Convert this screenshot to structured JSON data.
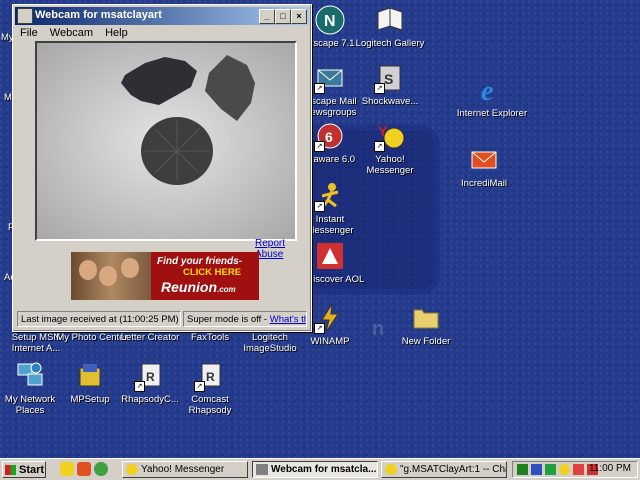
{
  "window": {
    "title": "Webcam for msatclayart",
    "menu": [
      "File",
      "Webcam",
      "Help"
    ],
    "report_abuse": "Report Abuse",
    "ad": {
      "line1": "Find your friends-",
      "line2": "CLICK HERE",
      "logo": "Reunion",
      "logo_suffix": ".com"
    },
    "status_left": "Last image received at (11:00:25 PM)",
    "status_right": "Super mode is off - ",
    "status_link": "What's this?"
  },
  "desktop": {
    "icons": [
      {
        "name": "netscape-7-1",
        "label": "etscape 7.1",
        "color": "#1a6b6b"
      },
      {
        "name": "logitech-gallery",
        "label": "Logitech Gallery",
        "color": "#f0f0f0"
      },
      {
        "name": "netscape-mail",
        "label": "etscape Mail Newsgroups",
        "color": "#3a7a9a"
      },
      {
        "name": "shockwave",
        "label": "Shockwave...",
        "color": "#c0c0c0"
      },
      {
        "name": "internet-explorer",
        "label": "Internet Explorer",
        "color": "#2a7ad0"
      },
      {
        "name": "ad-aware",
        "label": "d-aware 6.0",
        "color": "#c03030"
      },
      {
        "name": "yahoo-messenger",
        "label": "Yahoo! Messenger",
        "color": "#d02020"
      },
      {
        "name": "incredimail",
        "label": "IncrediMail",
        "color": "#e05020"
      },
      {
        "name": "instant-messenger",
        "label": "Instant Messenger",
        "color": "#f0c020"
      },
      {
        "name": "rediscover-aol",
        "label": "Rediscover AOL",
        "color": "#d03030"
      },
      {
        "name": "winamp",
        "label": "WINAMP",
        "color": "#d0a020"
      },
      {
        "name": "new-folder",
        "label": "New Folder",
        "color": "#e8d070"
      },
      {
        "name": "setup-msn",
        "label": "Setup MSN Internet A...",
        "color": "#3060c0"
      },
      {
        "name": "my-photo-center",
        "label": "My Photo Center",
        "color": "#c0c0c0"
      },
      {
        "name": "letter-creator",
        "label": "Letter Creator",
        "color": "#c0c0c0"
      },
      {
        "name": "faxtools",
        "label": "FaxTools",
        "color": "#c0c0c0"
      },
      {
        "name": "logitech-imagestudio",
        "label": "Logitech ImageStudio",
        "color": "#c0c0c0"
      },
      {
        "name": "my-network-places",
        "label": "My Network Places",
        "color": "#50a0d0"
      },
      {
        "name": "mpsetup",
        "label": "MPSetup",
        "color": "#e0c030"
      },
      {
        "name": "rhapsody-c",
        "label": "RhapsodyC...",
        "color": "#e0e0e0"
      },
      {
        "name": "comcast-rhapsody",
        "label": "Comcast Rhapsody",
        "color": "#e0e0e0"
      }
    ],
    "cut_labels": [
      "My",
      "My",
      "P",
      "Ac"
    ]
  },
  "taskbar": {
    "start": "Start",
    "tasks": [
      {
        "label": "Yahoo! Messenger",
        "active": false
      },
      {
        "label": "Webcam for msatcla...",
        "active": true
      },
      {
        "label": "\"g.MSATClayArt:1 -- Chat",
        "active": false
      }
    ],
    "clock": "11:00 PM"
  }
}
